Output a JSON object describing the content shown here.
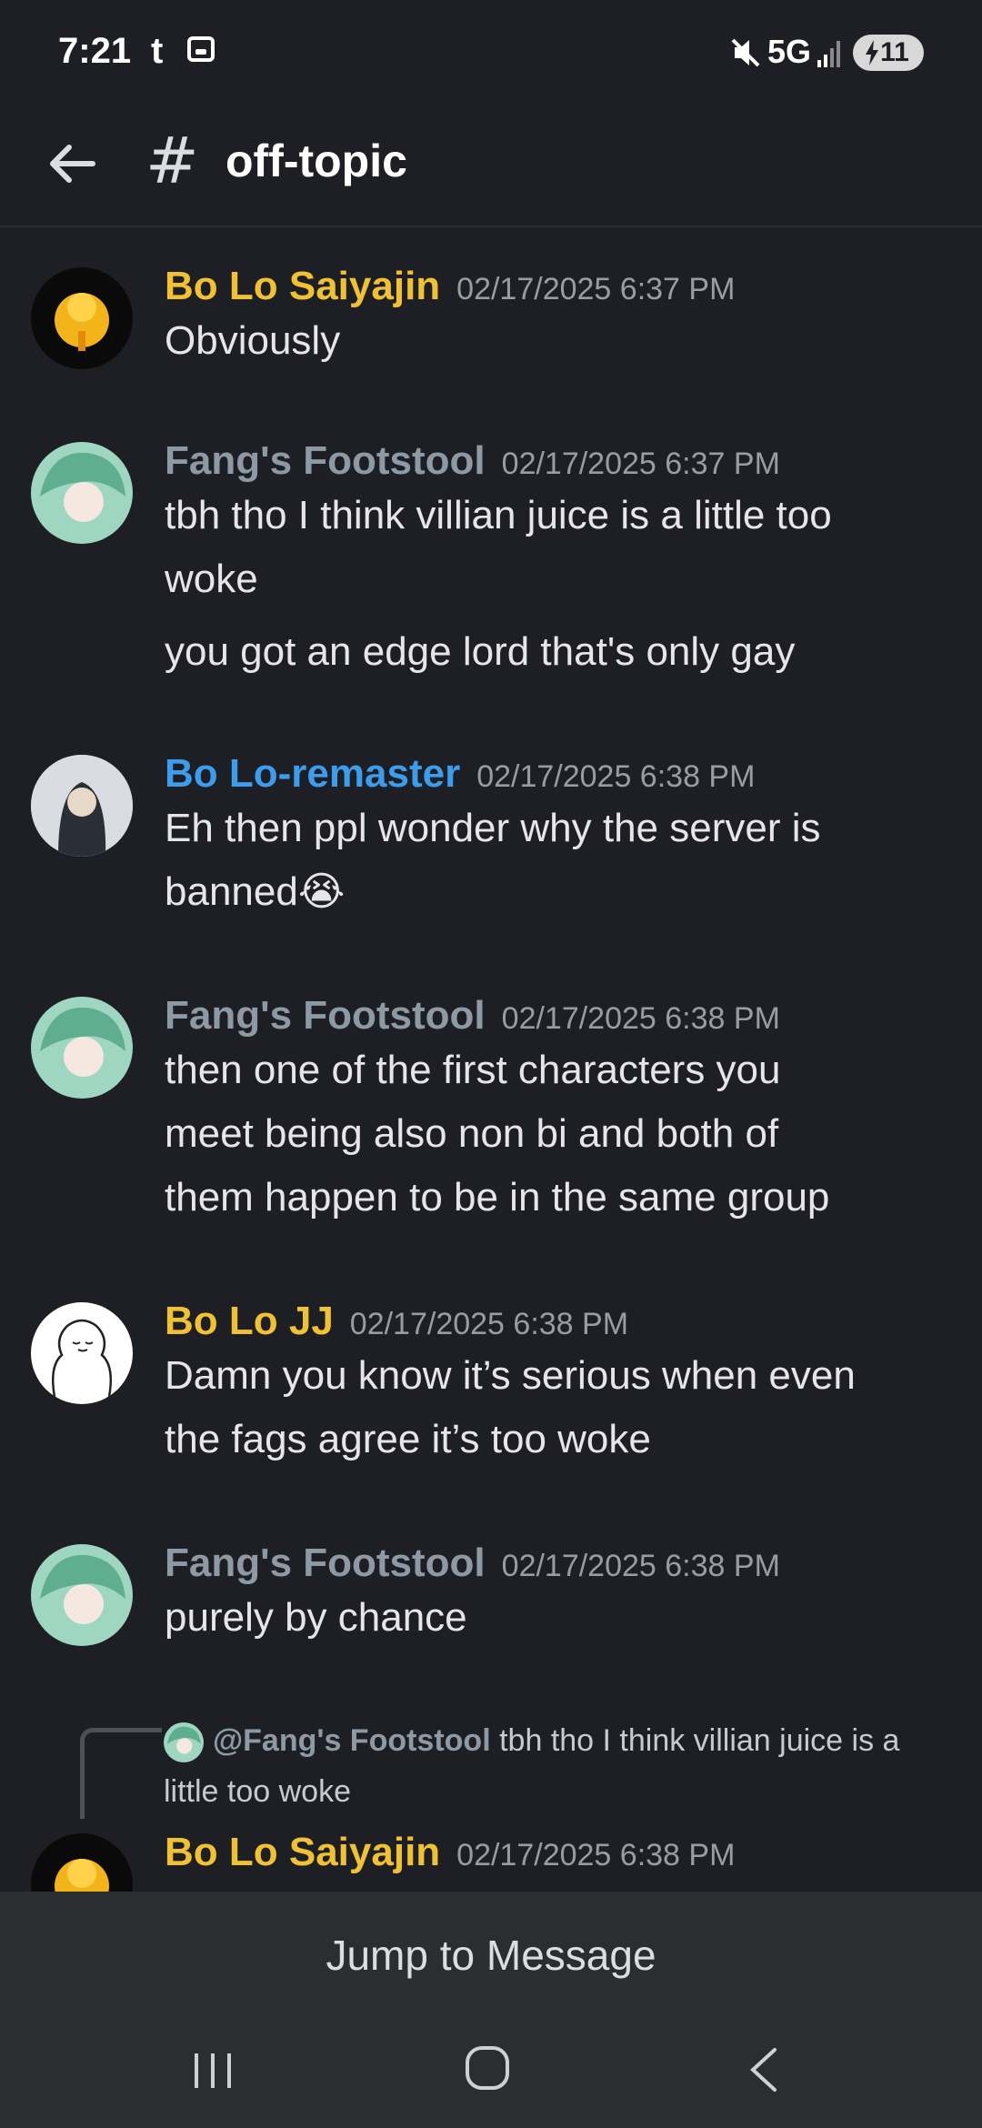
{
  "status_bar": {
    "time": "7:21",
    "app_letter": "t",
    "network": "5G",
    "battery": "11"
  },
  "header": {
    "channel": "off-topic"
  },
  "messages": [
    {
      "user": "Bo Lo Saiyajin",
      "timestamp": "02/17/2025 6:37 PM",
      "lines": [
        "Obviously"
      ]
    },
    {
      "user": "Fang's Footstool",
      "timestamp": "02/17/2025 6:37 PM",
      "lines": [
        "tbh tho I think villian juice is a little too",
        "woke",
        "you got an edge lord that's only gay"
      ]
    },
    {
      "user": "Bo Lo-remaster",
      "timestamp": "02/17/2025 6:38 PM",
      "lines": [
        "Eh then ppl wonder why the server is",
        "banned😭"
      ]
    },
    {
      "user": "Fang's Footstool",
      "timestamp": "02/17/2025 6:38 PM",
      "lines": [
        "then one of the first characters you",
        "meet being also non bi and both of",
        "them happen to be in the same group"
      ]
    },
    {
      "user": "Bo Lo JJ",
      "timestamp": "02/17/2025 6:38 PM",
      "lines": [
        "Damn you know it’s serious when even",
        "the fags agree it’s too woke"
      ]
    },
    {
      "user": "Fang's Footstool",
      "timestamp": "02/17/2025 6:38 PM",
      "lines": [
        "purely by chance"
      ]
    },
    {
      "user": "Bo Lo Saiyajin",
      "timestamp": "02/17/2025 6:38 PM",
      "lines": []
    }
  ],
  "reply": {
    "mention": "@Fang's Footstool",
    "text": " tbh tho I think villian juice is a little too woke"
  },
  "jump_button": "Jump to Message",
  "colors": {
    "gold": "#f0c232",
    "grey": "#8d9aa5",
    "blue": "#3c9ded",
    "background": "#1e1f24"
  }
}
